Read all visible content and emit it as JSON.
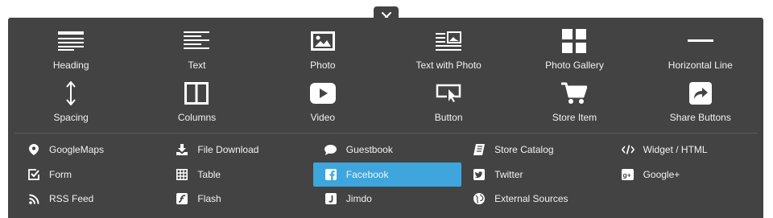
{
  "close": {
    "icon": "close-icon"
  },
  "elements": [
    {
      "label": "Heading",
      "icon": "heading-icon"
    },
    {
      "label": "Text",
      "icon": "text-icon"
    },
    {
      "label": "Photo",
      "icon": "photo-icon"
    },
    {
      "label": "Text with Photo",
      "icon": "text-with-photo-icon"
    },
    {
      "label": "Photo Gallery",
      "icon": "photo-gallery-icon"
    },
    {
      "label": "Horizontal Line",
      "icon": "horizontal-line-icon"
    },
    {
      "label": "Spacing",
      "icon": "spacing-icon"
    },
    {
      "label": "Columns",
      "icon": "columns-icon"
    },
    {
      "label": "Video",
      "icon": "video-icon"
    },
    {
      "label": "Button",
      "icon": "button-icon"
    },
    {
      "label": "Store Item",
      "icon": "cart-icon"
    },
    {
      "label": "Share Buttons",
      "icon": "share-icon"
    }
  ],
  "widgets": [
    {
      "label": "GoogleMaps",
      "icon": "map-pin-icon"
    },
    {
      "label": "File Download",
      "icon": "download-icon"
    },
    {
      "label": "Guestbook",
      "icon": "speech-bubble-icon"
    },
    {
      "label": "Store Catalog",
      "icon": "catalog-icon"
    },
    {
      "label": "Widget / HTML",
      "icon": "code-icon"
    },
    {
      "label": "Form",
      "icon": "form-checkbox-icon"
    },
    {
      "label": "Table",
      "icon": "table-icon"
    },
    {
      "label": "Facebook",
      "icon": "facebook-icon",
      "active": true
    },
    {
      "label": "Twitter",
      "icon": "twitter-icon"
    },
    {
      "label": "Google+",
      "icon": "google-plus-icon"
    },
    {
      "label": "RSS Feed",
      "icon": "rss-icon"
    },
    {
      "label": "Flash",
      "icon": "flash-icon"
    },
    {
      "label": "Jimdo",
      "icon": "jimdo-icon"
    },
    {
      "label": "External Sources",
      "icon": "globe-icon"
    }
  ],
  "colors": {
    "panel": "#434343",
    "active": "#3ea6dc",
    "text": "#f2f2f2",
    "divider": "#5c5c5c"
  }
}
